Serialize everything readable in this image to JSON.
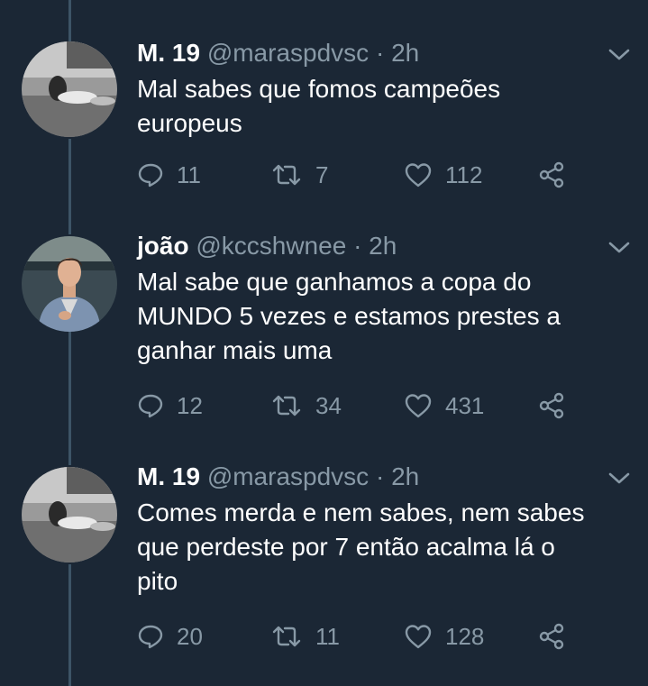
{
  "tweets": [
    {
      "name": "M. 19",
      "handle": "@maraspdvsc",
      "separator": "·",
      "time": "2h",
      "text_lines": [
        "Mal sabes que fomos campeões",
        "europeus"
      ],
      "replies": "11",
      "retweets": "7",
      "likes": "112"
    },
    {
      "name": "joão",
      "handle": "@kccshwnee",
      "separator": "·",
      "time": "2h",
      "text_lines": [
        "Mal sabe que ganhamos a copa do",
        "MUNDO 5 vezes e estamos prestes a",
        "ganhar mais uma"
      ],
      "replies": "12",
      "retweets": "34",
      "likes": "431"
    },
    {
      "name": "M. 19",
      "handle": "@maraspdvsc",
      "separator": "·",
      "time": "2h",
      "text_lines": [
        "Comes merda e nem sabes, nem sabes",
        "que perdeste por 7 então acalma lá o",
        "pito"
      ],
      "replies": "20",
      "retweets": "11",
      "likes": "128"
    }
  ],
  "icons": {
    "reply": "reply-icon",
    "retweet": "retweet-icon",
    "like": "heart-icon",
    "share": "share-icon",
    "menu": "chevron-down-icon"
  },
  "colors": {
    "background": "#1b2735",
    "text": "#ffffff",
    "secondary": "#8899a6",
    "thread_line": "#3d5466"
  }
}
